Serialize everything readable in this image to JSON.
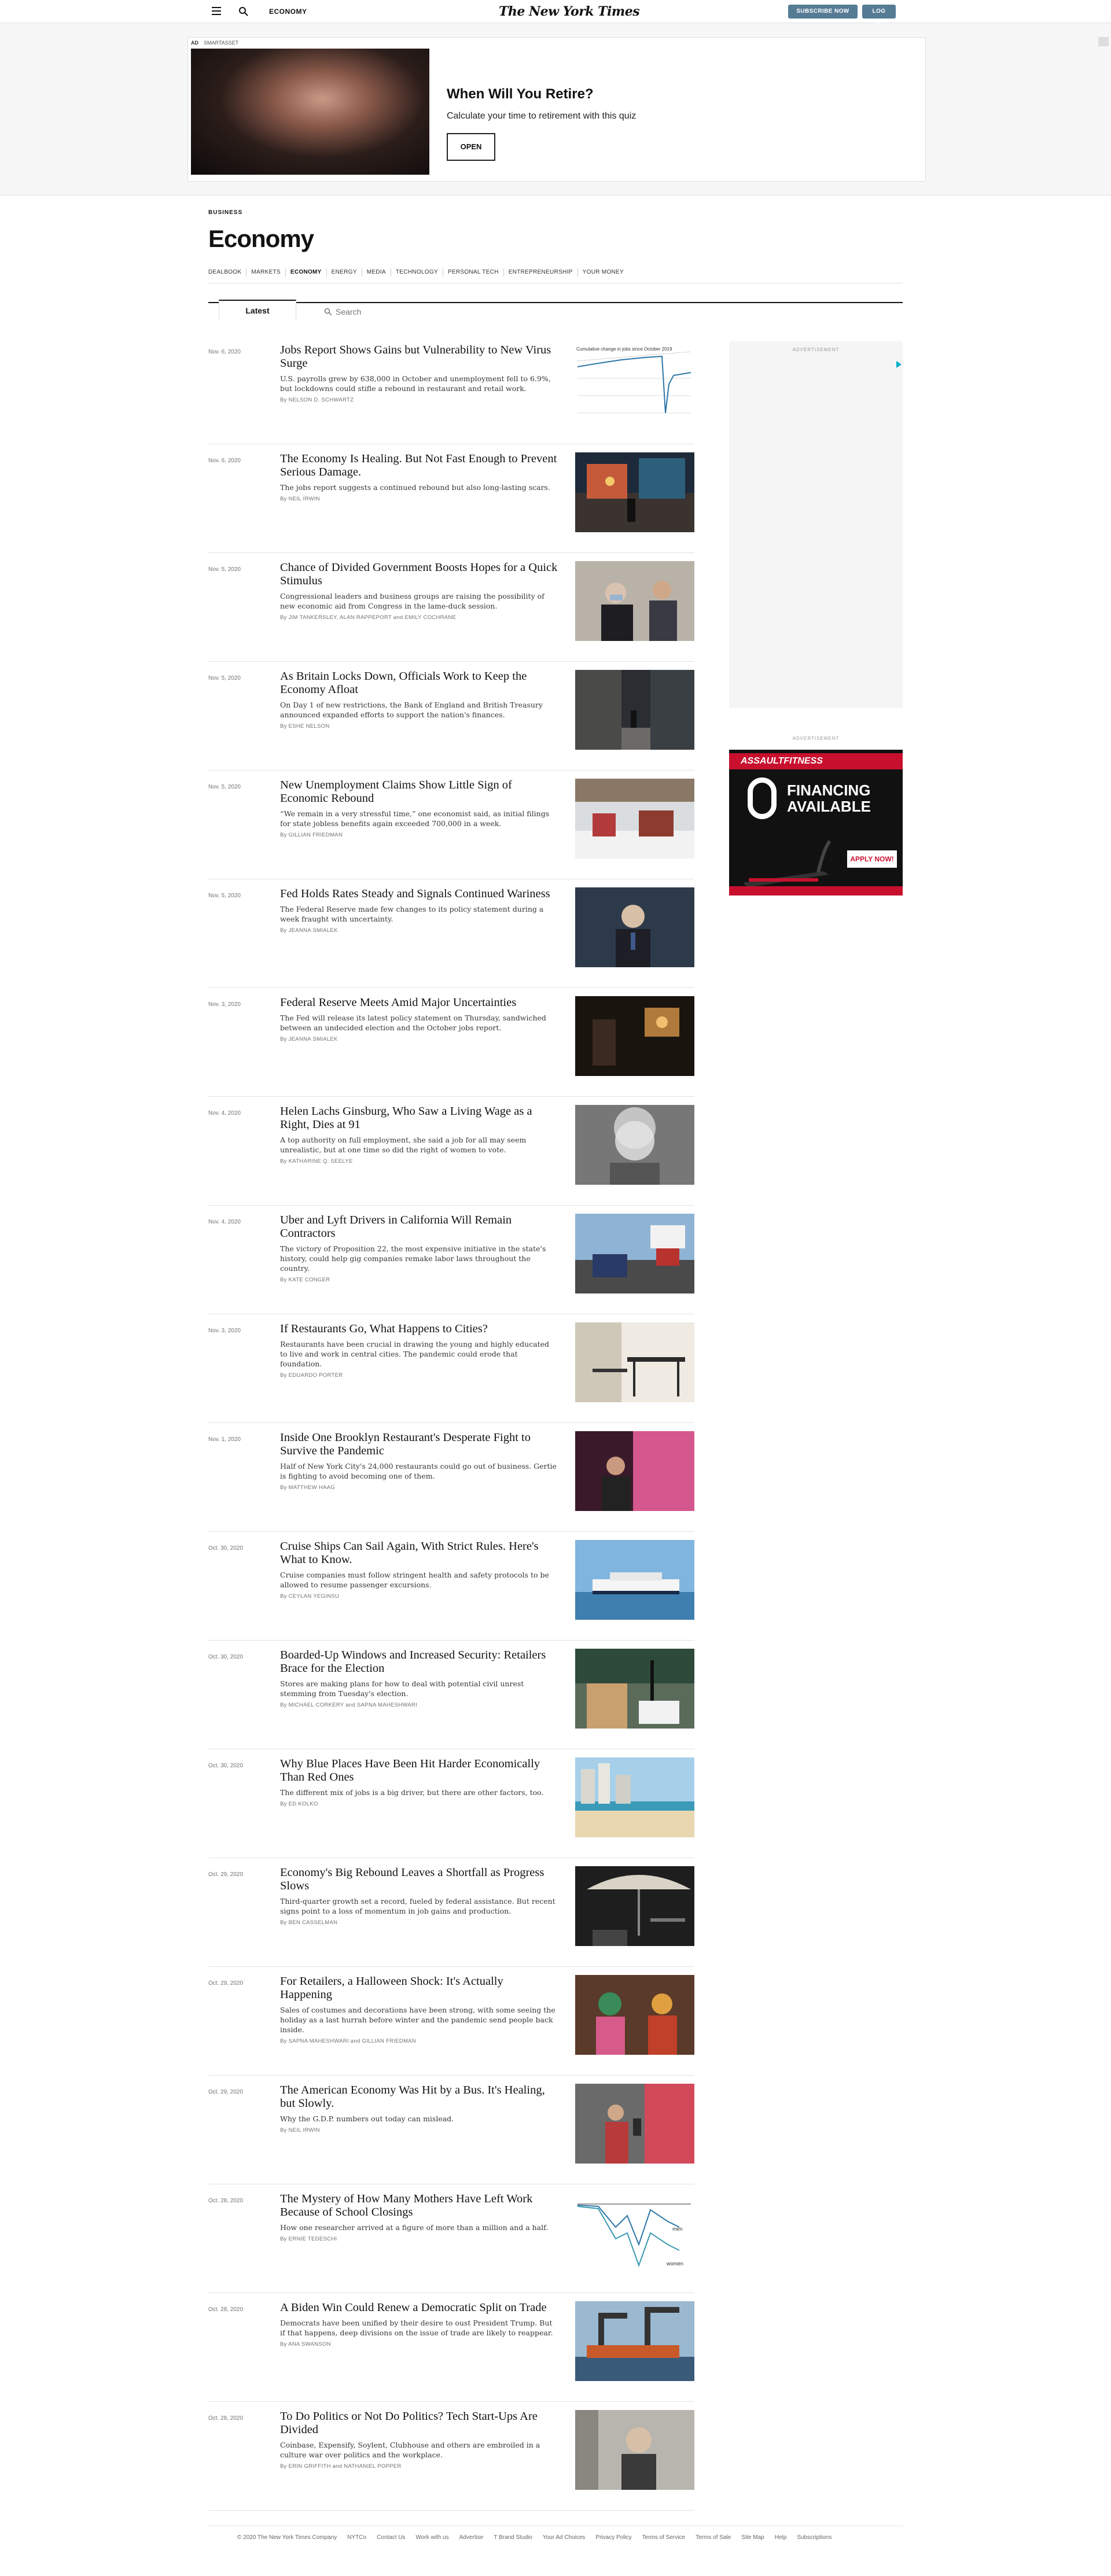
{
  "topnav": {
    "section": "ECONOMY",
    "logo": "The New York Times",
    "subscribe": "SUBSCRIBE NOW",
    "login": "LOG IN"
  },
  "ad": {
    "label": "AD",
    "sponsor": "SMARTASSET",
    "title": "When Will You Retire?",
    "subtitle": "Calculate your time to retirement with this quiz",
    "button": "OPEN"
  },
  "section": {
    "kicker": "BUSINESS",
    "title": "Economy",
    "subnav": [
      "DEALBOOK",
      "MARKETS",
      "ECONOMY",
      "ENERGY",
      "MEDIA",
      "TECHNOLOGY",
      "PERSONAL TECH",
      "ENTREPRENEURSHIP",
      "YOUR MONEY"
    ],
    "active_subnav": "ECONOMY"
  },
  "tabs": {
    "latest": "Latest",
    "search_placeholder": "Search"
  },
  "articles": [
    {
      "date": "Nov. 6, 2020",
      "headline": "Jobs Report Shows Gains but Vulnerability to New Virus Surge",
      "summary": "U.S. payrolls grew by 638,000 in October and unemployment fell to 6.9%, but lockdowns could stifle a rebound in restaurant and retail work.",
      "byline": "By NELSON D. SCHWARTZ",
      "thumb": "chart-payrolls"
    },
    {
      "date": "Nov. 6, 2020",
      "headline": "The Economy Is Healing. But Not Fast Enough to Prevent Serious Damage.",
      "summary": "The jobs report suggests a continued rebound but also long-lasting scars.",
      "byline": "By NEIL IRWIN",
      "thumb": "street-night"
    },
    {
      "date": "Nov. 5, 2020",
      "headline": "Chance of Divided Government Boosts Hopes for a Quick Stimulus",
      "summary": "Congressional leaders and business groups are raising the possibility of new economic aid from Congress in the lame-duck session.",
      "byline": "By JIM TANKERSLEY, ALAN RAPPEPORT and EMILY COCHRANE",
      "thumb": "masked-officials"
    },
    {
      "date": "Nov. 5, 2020",
      "headline": "As Britain Locks Down, Officials Work to Keep the Economy Afloat",
      "summary": "On Day 1 of new restrictions, the Bank of England and British Treasury announced expanded efforts to support the nation's finances.",
      "byline": "By ESHE NELSON",
      "thumb": "london-street"
    },
    {
      "date": "Nov. 5, 2020",
      "headline": "New Unemployment Claims Show Little Sign of Economic Rebound",
      "summary": "“We remain in a very stressful time,” one economist said, as initial filings for state jobless benefits again exceeded 700,000 in a week.",
      "byline": "By GILLIAN FRIEDMAN",
      "thumb": "snowy-dining"
    },
    {
      "date": "Nov. 5, 2020",
      "headline": "Fed Holds Rates Steady and Signals Continued Wariness",
      "summary": "The Federal Reserve made few changes to its policy statement during a week fraught with uncertainty.",
      "byline": "By JEANNA SMIALEK",
      "thumb": "powell"
    },
    {
      "date": "Nov. 3, 2020",
      "headline": "Federal Reserve Meets Amid Major Uncertainties",
      "summary": "The Fed will release its latest policy statement on Thursday, sandwiched between an undecided election and the October jobs report.",
      "byline": "By JEANNA SMIALEK",
      "thumb": "dark-room"
    },
    {
      "date": "Nov. 4, 2020",
      "headline": "Helen Lachs Ginsburg, Who Saw a Living Wage as a Right, Dies at 91",
      "summary": "A top authority on full employment, she said a job for all may seem unrealistic, but at one time so did the right of women to vote.",
      "byline": "By KATHARINE Q. SEELYE",
      "thumb": "portrait-bw"
    },
    {
      "date": "Nov. 4, 2020",
      "headline": "Uber and Lyft Drivers in California Will Remain Contractors",
      "summary": "The victory of Proposition 22, the most expensive initiative in the state's history, could help gig companies remake labor laws throughout the country.",
      "byline": "By KATE CONGER",
      "thumb": "protest"
    },
    {
      "date": "Nov. 3, 2020",
      "headline": "If Restaurants Go, What Happens to Cities?",
      "summary": "Restaurants have been crucial in drawing the young and highly educated to live and work in central cities. The pandemic could erode that foundation.",
      "byline": "By EDUARDO PORTER",
      "thumb": "empty-restaurant"
    },
    {
      "date": "Nov. 1, 2020",
      "headline": "Inside One Brooklyn Restaurant's Desperate Fight to Survive the Pandemic",
      "summary": "Half of New York City's 24,000 restaurants could go out of business. Gertie is fighting to avoid becoming one of them.",
      "byline": "By MATTHEW HAAG",
      "thumb": "pink-restaurant"
    },
    {
      "date": "Oct. 30, 2020",
      "headline": "Cruise Ships Can Sail Again, With Strict Rules. Here's What to Know.",
      "summary": "Cruise companies must follow stringent health and safety protocols to be allowed to resume passenger excursions.",
      "byline": "By CEYLAN YEGINSU",
      "thumb": "cruise-ship"
    },
    {
      "date": "Oct. 30, 2020",
      "headline": "Boarded-Up Windows and Increased Security: Retailers Brace for the Election",
      "summary": "Stores are making plans for how to deal with potential civil unrest stemming from Tuesday's election.",
      "byline": "By MICHAEL CORKERY and SAPNA MAHESHWARI",
      "thumb": "boarded-windows"
    },
    {
      "date": "Oct. 30, 2020",
      "headline": "Why Blue Places Have Been Hit Harder Economically Than Red Ones",
      "summary": "The different mix of jobs is a big driver, but there are other factors, too.",
      "byline": "By ED KOLKO",
      "thumb": "beach-city"
    },
    {
      "date": "Oct. 29, 2020",
      "headline": "Economy's Big Rebound Leaves a Shortfall as Progress Slows",
      "summary": "Third-quarter growth set a record, fueled by federal assistance. But recent signs point to a loss of momentum in job gains and production.",
      "byline": "By BEN CASSELMAN",
      "thumb": "umbrella-dark"
    },
    {
      "date": "Oct. 29, 2020",
      "headline": "For Retailers, a Halloween Shock: It's Actually Happening",
      "summary": "Sales of costumes and decorations have been strong, with some seeing the holiday as a last hurrah before winter and the pandemic send people back inside.",
      "byline": "By SAPNA MAHESHWARI and GILLIAN FRIEDMAN",
      "thumb": "halloween"
    },
    {
      "date": "Oct. 29, 2020",
      "headline": "The American Economy Was Hit by a Bus. It's Healing, but Slowly.",
      "summary": "Why the G.D.P. numbers out today can mislead.",
      "byline": "By NEIL IRWIN",
      "thumb": "shopper"
    },
    {
      "date": "Oct. 28, 2020",
      "headline": "The Mystery of How Many Mothers Have Left Work Because of School Closings",
      "summary": "How one researcher arrived at a figure of more than a million and a half.",
      "byline": "By ERNIE TEDESCHI",
      "thumb": "chart-mothers"
    },
    {
      "date": "Oct. 28, 2020",
      "headline": "A Biden Win Could Renew a Democratic Split on Trade",
      "summary": "Democrats have been unified by their desire to oust President Trump. But if that happens, deep divisions on the issue of trade are likely to reappear.",
      "byline": "By ANA SWANSON",
      "thumb": "port-cranes"
    },
    {
      "date": "Oct. 28, 2020",
      "headline": "To Do Politics or Not Do Politics? Tech Start-Ups Are Divided",
      "summary": "Coinbase, Expensify, Soylent, Clubhouse and others are embroiled in a culture war over politics and the workplace.",
      "byline": "By ERIN GRIFFITH and NATHANIEL POPPER",
      "thumb": "portrait-man"
    }
  ],
  "thumb_charts": {
    "payrolls_caption": "Cumulative change in jobs since October 2019",
    "mothers_men": "men",
    "mothers_women": "women"
  },
  "sidebar": {
    "ad_label": "ADVERTISEMENT",
    "ad2_label": "ADVERTISEMENT",
    "ad2_brand": "ASSAULTFITNESS",
    "ad2_offer": "FINANCING AVAILABLE",
    "ad2_button": "APPLY NOW!"
  },
  "footer": [
    "© 2020 The New York Times Company",
    "NYTCo",
    "Contact Us",
    "Work with us",
    "Advertise",
    "T Brand Studio",
    "Your Ad Choices",
    "Privacy Policy",
    "Terms of Service",
    "Terms of Sale",
    "Site Map",
    "Help",
    "Subscriptions"
  ],
  "colors": {
    "button": "#567b95",
    "rule": "#e2e2e2",
    "ad_red": "#c8102e"
  }
}
